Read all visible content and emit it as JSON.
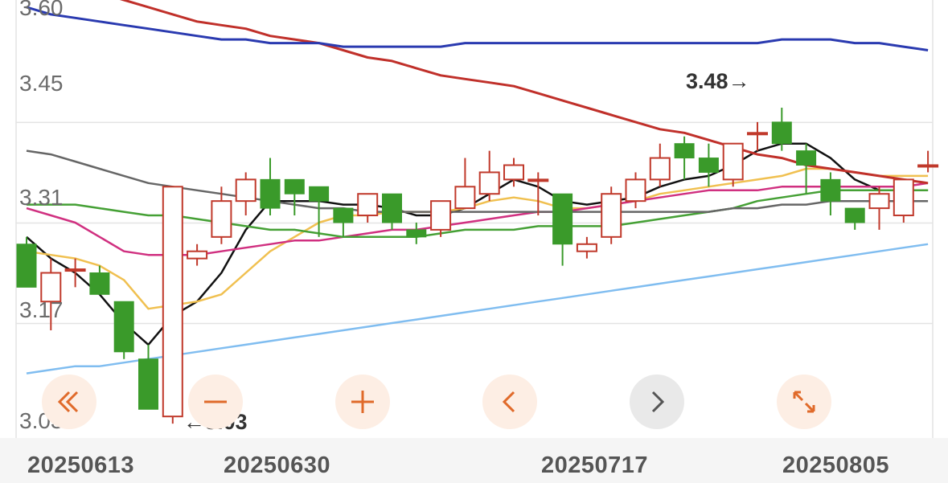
{
  "y_labels": [
    "3.60",
    "3.45",
    "3.31",
    "3.17",
    "3.03"
  ],
  "x_labels": [
    "20250613",
    "20250630",
    "20250717",
    "20250805"
  ],
  "markers": {
    "high": {
      "text": "3.48",
      "arrow": "→"
    },
    "low": {
      "text": "3.03",
      "arrow": "←"
    }
  },
  "controls": [
    {
      "name": "fast-backward",
      "icon": "double-chevron-left-icon"
    },
    {
      "name": "zoom-out",
      "icon": "minus-icon"
    },
    {
      "name": "zoom-in",
      "icon": "plus-icon"
    },
    {
      "name": "step-back",
      "icon": "chevron-left-icon"
    },
    {
      "name": "step-forward",
      "icon": "chevron-right-icon"
    },
    {
      "name": "fullscreen",
      "icon": "expand-icon"
    }
  ],
  "colors": {
    "up": "#c0392b",
    "down": "#3a9a2a",
    "ma5": "#111111",
    "ma10": "#f0c050",
    "ma20": "#d03080",
    "ma30": "#45a035",
    "ma60": "#666666",
    "ma120": "#c0302a",
    "ma250": "#2a3ab0",
    "ma_long": "#80bdf0",
    "accent": "#e06a2a"
  },
  "chart_data": {
    "type": "candlestick",
    "ylim": [
      3.01,
      3.62
    ],
    "grid": true,
    "candles": [
      {
        "o": 3.28,
        "c": 3.22,
        "h": 3.29,
        "l": 3.22
      },
      {
        "o": 3.2,
        "c": 3.24,
        "h": 3.26,
        "l": 3.16
      },
      {
        "o": 3.245,
        "c": 3.245,
        "h": 3.26,
        "l": 3.22
      },
      {
        "o": 3.24,
        "c": 3.21,
        "h": 3.25,
        "l": 3.21
      },
      {
        "o": 3.2,
        "c": 3.13,
        "h": 3.2,
        "l": 3.12
      },
      {
        "o": 3.12,
        "c": 3.05,
        "h": 3.14,
        "l": 3.05
      },
      {
        "o": 3.04,
        "c": 3.36,
        "h": 3.36,
        "l": 3.03
      },
      {
        "o": 3.26,
        "c": 3.27,
        "h": 3.28,
        "l": 3.25
      },
      {
        "o": 3.29,
        "c": 3.34,
        "h": 3.36,
        "l": 3.28
      },
      {
        "o": 3.34,
        "c": 3.37,
        "h": 3.38,
        "l": 3.32
      },
      {
        "o": 3.37,
        "c": 3.33,
        "h": 3.4,
        "l": 3.32
      },
      {
        "o": 3.37,
        "c": 3.35,
        "h": 3.37,
        "l": 3.32
      },
      {
        "o": 3.36,
        "c": 3.34,
        "h": 3.36,
        "l": 3.29
      },
      {
        "o": 3.33,
        "c": 3.31,
        "h": 3.33,
        "l": 3.29
      },
      {
        "o": 3.32,
        "c": 3.35,
        "h": 3.35,
        "l": 3.31
      },
      {
        "o": 3.35,
        "c": 3.31,
        "h": 3.35,
        "l": 3.3
      },
      {
        "o": 3.3,
        "c": 3.29,
        "h": 3.31,
        "l": 3.28
      },
      {
        "o": 3.3,
        "c": 3.34,
        "h": 3.34,
        "l": 3.29
      },
      {
        "o": 3.33,
        "c": 3.36,
        "h": 3.4,
        "l": 3.33
      },
      {
        "o": 3.35,
        "c": 3.38,
        "h": 3.41,
        "l": 3.34
      },
      {
        "o": 3.37,
        "c": 3.39,
        "h": 3.4,
        "l": 3.36
      },
      {
        "o": 3.37,
        "c": 3.37,
        "h": 3.38,
        "l": 3.32
      },
      {
        "o": 3.35,
        "c": 3.28,
        "h": 3.35,
        "l": 3.25
      },
      {
        "o": 3.27,
        "c": 3.28,
        "h": 3.29,
        "l": 3.26
      },
      {
        "o": 3.29,
        "c": 3.35,
        "h": 3.36,
        "l": 3.28
      },
      {
        "o": 3.34,
        "c": 3.37,
        "h": 3.38,
        "l": 3.33
      },
      {
        "o": 3.37,
        "c": 3.4,
        "h": 3.42,
        "l": 3.36
      },
      {
        "o": 3.42,
        "c": 3.4,
        "h": 3.43,
        "l": 3.37
      },
      {
        "o": 3.4,
        "c": 3.38,
        "h": 3.42,
        "l": 3.36
      },
      {
        "o": 3.37,
        "c": 3.42,
        "h": 3.42,
        "l": 3.36
      },
      {
        "o": 3.435,
        "c": 3.435,
        "h": 3.45,
        "l": 3.41
      },
      {
        "o": 3.45,
        "c": 3.42,
        "h": 3.47,
        "l": 3.41
      },
      {
        "o": 3.41,
        "c": 3.39,
        "h": 3.42,
        "l": 3.35
      },
      {
        "o": 3.37,
        "c": 3.34,
        "h": 3.38,
        "l": 3.32
      },
      {
        "o": 3.33,
        "c": 3.31,
        "h": 3.33,
        "l": 3.3
      },
      {
        "o": 3.33,
        "c": 3.35,
        "h": 3.36,
        "l": 3.3
      },
      {
        "o": 3.32,
        "c": 3.37,
        "h": 3.37,
        "l": 3.31
      },
      {
        "o": 3.39,
        "c": 3.39,
        "h": 3.41,
        "l": 3.38
      }
    ],
    "series": [
      {
        "values": [
          3.29,
          3.26,
          3.24,
          3.21,
          3.17,
          3.14,
          3.18,
          3.2,
          3.24,
          3.3,
          3.34,
          3.34,
          3.34,
          3.335,
          3.335,
          3.33,
          3.32,
          3.32,
          3.33,
          3.35,
          3.37,
          3.36,
          3.34,
          3.335,
          3.34,
          3.345,
          3.36,
          3.37,
          3.375,
          3.39,
          3.41,
          3.42,
          3.42,
          3.4,
          3.37,
          3.355,
          3.355,
          3.355
        ]
      },
      {
        "values": [
          3.27,
          3.265,
          3.26,
          3.25,
          3.23,
          3.19,
          3.195,
          3.2,
          3.21,
          3.24,
          3.27,
          3.29,
          3.31,
          3.32,
          3.32,
          3.325,
          3.325,
          3.325,
          3.33,
          3.34,
          3.345,
          3.34,
          3.33,
          3.33,
          3.335,
          3.34,
          3.35,
          3.355,
          3.36,
          3.365,
          3.37,
          3.375,
          3.385,
          3.385,
          3.38,
          3.375,
          3.375,
          3.375
        ]
      },
      {
        "values": [
          3.33,
          3.32,
          3.31,
          3.29,
          3.27,
          3.265,
          3.265,
          3.265,
          3.27,
          3.275,
          3.28,
          3.285,
          3.285,
          3.29,
          3.295,
          3.3,
          3.3,
          3.305,
          3.31,
          3.315,
          3.32,
          3.325,
          3.325,
          3.33,
          3.335,
          3.34,
          3.345,
          3.35,
          3.355,
          3.355,
          3.355,
          3.36,
          3.36,
          3.36,
          3.36,
          3.36,
          3.36,
          3.365
        ]
      },
      {
        "values": [
          3.335,
          3.335,
          3.335,
          3.33,
          3.325,
          3.32,
          3.32,
          3.315,
          3.31,
          3.305,
          3.3,
          3.3,
          3.295,
          3.29,
          3.29,
          3.29,
          3.29,
          3.295,
          3.3,
          3.3,
          3.3,
          3.305,
          3.305,
          3.305,
          3.305,
          3.31,
          3.315,
          3.32,
          3.325,
          3.33,
          3.34,
          3.345,
          3.35,
          3.355,
          3.355,
          3.355,
          3.355,
          3.355
        ]
      },
      {
        "values": [
          3.41,
          3.405,
          3.395,
          3.385,
          3.375,
          3.365,
          3.36,
          3.355,
          3.35,
          3.345,
          3.34,
          3.335,
          3.33,
          3.33,
          3.325,
          3.325,
          3.325,
          3.325,
          3.325,
          3.325,
          3.325,
          3.325,
          3.325,
          3.325,
          3.325,
          3.325,
          3.325,
          3.325,
          3.325,
          3.33,
          3.33,
          3.335,
          3.335,
          3.34,
          3.34,
          3.34,
          3.34,
          3.34
        ]
      },
      {
        "values": [
          3.66,
          3.65,
          3.64,
          3.63,
          3.62,
          3.61,
          3.6,
          3.59,
          3.585,
          3.58,
          3.57,
          3.565,
          3.56,
          3.55,
          3.54,
          3.535,
          3.525,
          3.515,
          3.51,
          3.505,
          3.5,
          3.49,
          3.48,
          3.47,
          3.46,
          3.45,
          3.44,
          3.435,
          3.425,
          3.415,
          3.405,
          3.4,
          3.39,
          3.385,
          3.38,
          3.375,
          3.37,
          3.365
        ]
      },
      {
        "values": [
          3.61,
          3.6,
          3.595,
          3.59,
          3.585,
          3.58,
          3.575,
          3.57,
          3.565,
          3.565,
          3.56,
          3.56,
          3.56,
          3.555,
          3.555,
          3.555,
          3.555,
          3.555,
          3.56,
          3.56,
          3.56,
          3.56,
          3.56,
          3.56,
          3.56,
          3.56,
          3.56,
          3.56,
          3.56,
          3.56,
          3.56,
          3.565,
          3.565,
          3.565,
          3.56,
          3.56,
          3.555,
          3.55
        ]
      },
      {
        "values": [
          3.1,
          3.105,
          3.11,
          3.11,
          3.115,
          3.12,
          3.125,
          3.13,
          3.135,
          3.14,
          3.145,
          3.15,
          3.155,
          3.16,
          3.165,
          3.17,
          3.175,
          3.18,
          3.185,
          3.19,
          3.195,
          3.2,
          3.205,
          3.21,
          3.215,
          3.22,
          3.225,
          3.23,
          3.235,
          3.24,
          3.245,
          3.25,
          3.255,
          3.26,
          3.265,
          3.27,
          3.275,
          3.28
        ]
      }
    ]
  }
}
